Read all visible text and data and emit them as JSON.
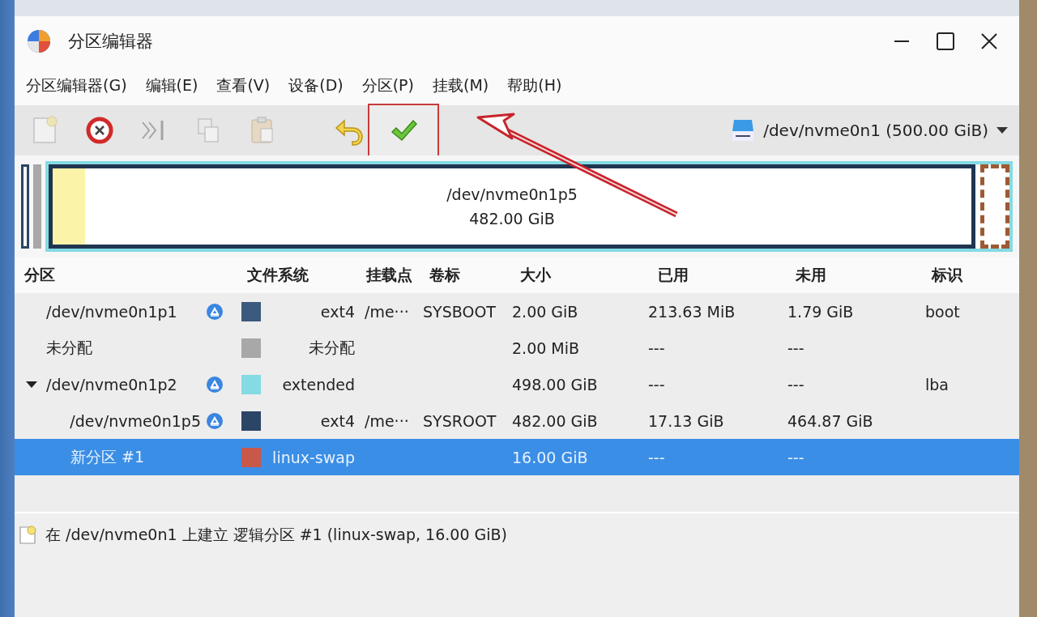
{
  "window": {
    "title": "分区编辑器"
  },
  "menu": [
    {
      "label": "分区编辑器(G)"
    },
    {
      "label": "编辑(E)"
    },
    {
      "label": "查看(V)"
    },
    {
      "label": "设备(D)"
    },
    {
      "label": "分区(P)"
    },
    {
      "label": "挂载(M)"
    },
    {
      "label": "帮助(H)"
    }
  ],
  "toolbar": [
    {
      "kind": "new",
      "disabled": true,
      "highlighted": false
    },
    {
      "kind": "delete",
      "disabled": false,
      "highlighted": false
    },
    {
      "kind": "resize",
      "disabled": true,
      "highlighted": false
    },
    {
      "kind": "copy",
      "disabled": true,
      "highlighted": false
    },
    {
      "kind": "paste",
      "disabled": true,
      "highlighted": false
    },
    {
      "kind": "undo",
      "disabled": false,
      "highlighted": false
    },
    {
      "kind": "apply",
      "disabled": false,
      "highlighted": true
    }
  ],
  "device": {
    "label": "/dev/nvme0n1 (500.00 GiB)"
  },
  "disk_map": [
    {
      "kind": "partition",
      "color": "#2b4566"
    },
    {
      "kind": "unallocated",
      "color": "#a8a8a8"
    },
    {
      "kind": "extended",
      "color": "#84dbe3",
      "children": [
        {
          "kind": "partition",
          "color": "#1f3550",
          "name": "/dev/nvme0n1p5",
          "size": "482.00 GiB",
          "level": 0.035
        },
        {
          "kind": "new",
          "color": "#9c5a34"
        }
      ]
    }
  ],
  "table": {
    "columns": [
      {
        "label": "分区"
      },
      {
        "label": "文件系统"
      },
      {
        "label": "挂载点"
      },
      {
        "label": "卷标"
      },
      {
        "label": "大小"
      },
      {
        "label": "已用"
      },
      {
        "label": "未用"
      },
      {
        "label": "标识"
      }
    ],
    "rows": [
      {
        "name": "/dev/nvme0n1p1",
        "mounted": true,
        "color": "#3c5a7e",
        "filesystem": "ext4",
        "mount_point": "/me···",
        "label": "SYSBOOT",
        "size": "2.00 GiB",
        "used": "213.63 MiB",
        "unused": "1.79 GiB",
        "flags": "boot",
        "selected": false
      },
      {
        "name": "未分配",
        "mounted": false,
        "color": "#a8a8a8",
        "filesystem": "未分配",
        "size": "2.00 MiB",
        "used": "---",
        "unused": "---",
        "selected": false
      },
      {
        "name": "/dev/nvme0n1p2",
        "mounted": true,
        "color": "#84dbe3",
        "filesystem": "extended",
        "size": "498.00 GiB",
        "used": "---",
        "unused": "---",
        "flags": "lba",
        "selected": false,
        "expanded": true,
        "children": [
          {
            "name": "/dev/nvme0n1p5",
            "mounted": true,
            "color": "#2b4566",
            "filesystem": "ext4",
            "mount_point": "/me···",
            "label": "SYSROOT",
            "size": "482.00 GiB",
            "used": "17.13 GiB",
            "unused": "464.87 GiB",
            "selected": false
          },
          {
            "name": "新分区 #1",
            "mounted": false,
            "color": "#c8584a",
            "filesystem": "linux-swap",
            "size": "16.00 GiB",
            "used": "---",
            "unused": "---",
            "selected": true
          }
        ]
      }
    ]
  },
  "operations": [
    {
      "text": "在 /dev/nvme0n1 上建立 逻辑分区 #1 (linux-swap, 16.00 GiB)"
    }
  ]
}
